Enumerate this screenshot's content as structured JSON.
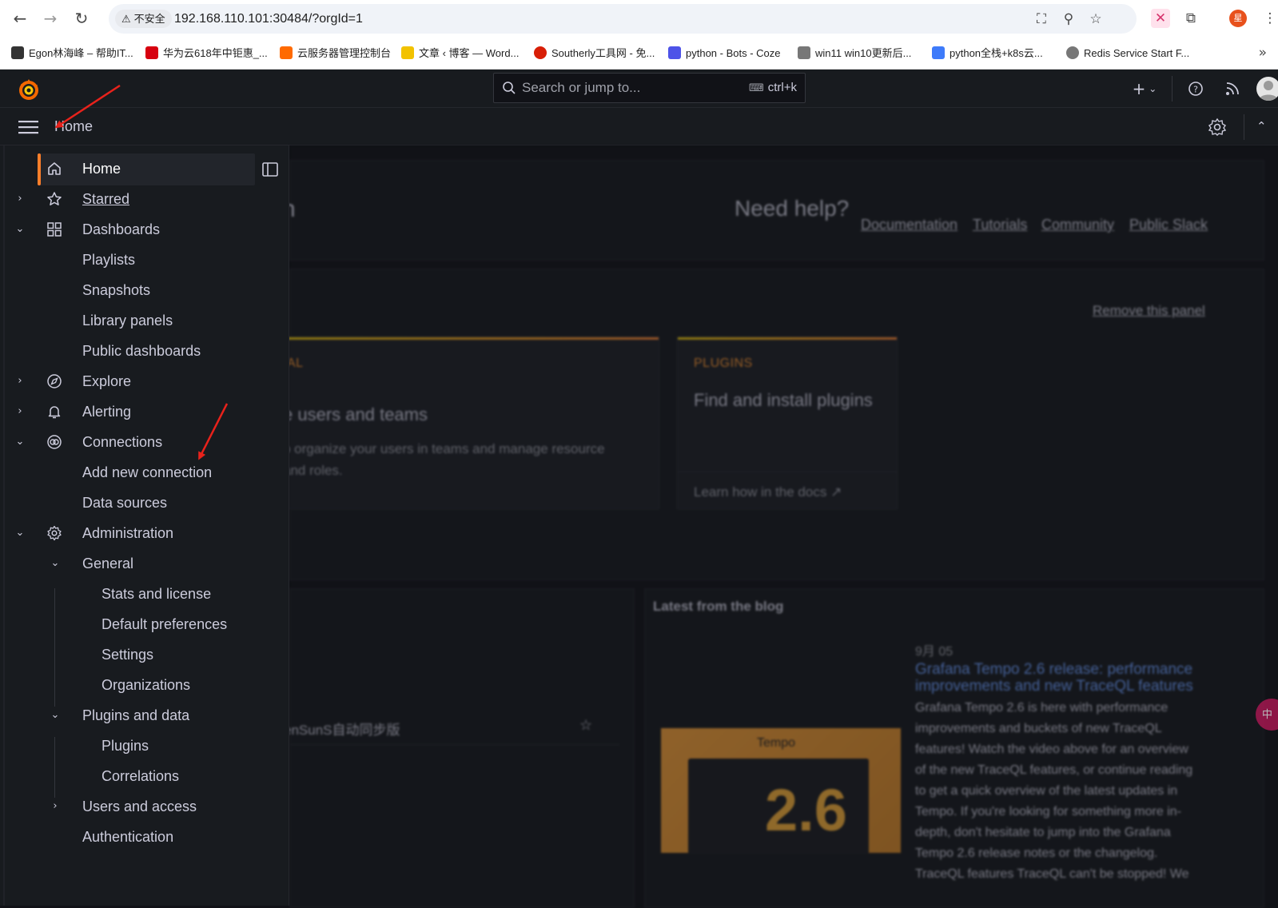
{
  "browser": {
    "insecure_label": "不安全",
    "url": "192.168.110.101:30484/?orgId=1",
    "bookmarks": [
      {
        "label": "Egon林海峰 – 帮助IT...",
        "color": "#333333"
      },
      {
        "label": "华为云618年中钜惠_...",
        "color": "#d7000f"
      },
      {
        "label": "云服务器管理控制台",
        "color": "#ff6a00"
      },
      {
        "label": "文章 ‹ 博客 — Word...",
        "color": "#f2c200"
      },
      {
        "label": "Southerly工具网 - 免...",
        "color": "#d81e06"
      },
      {
        "label": "python - Bots - Coze",
        "color": "#4d53e8"
      },
      {
        "label": "win11 win10更新后...",
        "color": "#555555"
      },
      {
        "label": "python全栈+k8s云...",
        "color": "#3e7bfa"
      },
      {
        "label": "Redis Service Start F...",
        "color": "#555555"
      }
    ],
    "profile_initial": "星"
  },
  "topbar": {
    "search_placeholder": "Search or jump to...",
    "shortcut": "ctrl+k",
    "plus_icon": "plus-icon",
    "help_icon": "help-icon",
    "news_icon": "rss-icon"
  },
  "breadcrumb": {
    "current": "Home"
  },
  "sidebar": {
    "items": [
      {
        "label": "Home"
      },
      {
        "label": "Starred"
      },
      {
        "label": "Dashboards"
      },
      {
        "label": "Playlists"
      },
      {
        "label": "Snapshots"
      },
      {
        "label": "Library panels"
      },
      {
        "label": "Public dashboards"
      },
      {
        "label": "Explore"
      },
      {
        "label": "Alerting"
      },
      {
        "label": "Connections"
      },
      {
        "label": "Add new connection"
      },
      {
        "label": "Data sources"
      },
      {
        "label": "Administration"
      },
      {
        "label": "General"
      },
      {
        "label": "Stats and license"
      },
      {
        "label": "Default preferences"
      },
      {
        "label": "Settings"
      },
      {
        "label": "Organizations"
      },
      {
        "label": "Plugins and data"
      },
      {
        "label": "Plugins"
      },
      {
        "label": "Correlations"
      },
      {
        "label": "Users and access"
      },
      {
        "label": "Authentication"
      }
    ]
  },
  "background": {
    "welcome_fragment": "n",
    "need_help": "Need help?",
    "help_links": [
      "Documentation",
      "Tutorials",
      "Community",
      "Public Slack"
    ],
    "remove_panel": "Remove this panel",
    "card1": {
      "category": "IAL",
      "title": "e users and teams",
      "desc_line1": "o organize your users in teams and manage resource",
      "desc_line2": "and roles."
    },
    "card2": {
      "category": "PLUGINS",
      "title": "Find and install plugins",
      "link": "Learn how in the docs"
    },
    "dashboard_item": "enSunS自动同步版",
    "blog": {
      "header": "Latest from the blog",
      "date": "9月 05",
      "title_line1": "Grafana Tempo 2.6 release: performance",
      "title_line2": "improvements and new TraceQL features",
      "body": [
        "Grafana Tempo 2.6 is here with performance",
        "improvements and buckets of new TraceQL",
        "features! Watch the video above for an overview",
        "of the new TraceQL features, or continue reading",
        "to get a quick overview of the latest updates in",
        "Tempo. If you're looking for something more in-",
        "depth, don't hesitate to jump into the Grafana",
        "Tempo 2.6 release notes or the changelog.",
        "TraceQL features TraceQL can't be stopped! We"
      ],
      "image_brand": "Tempo",
      "image_version": "2.6"
    }
  },
  "colors": {
    "accent": "#ff7f2a",
    "link": "#6e9fff",
    "annotation": "#e8221b"
  }
}
